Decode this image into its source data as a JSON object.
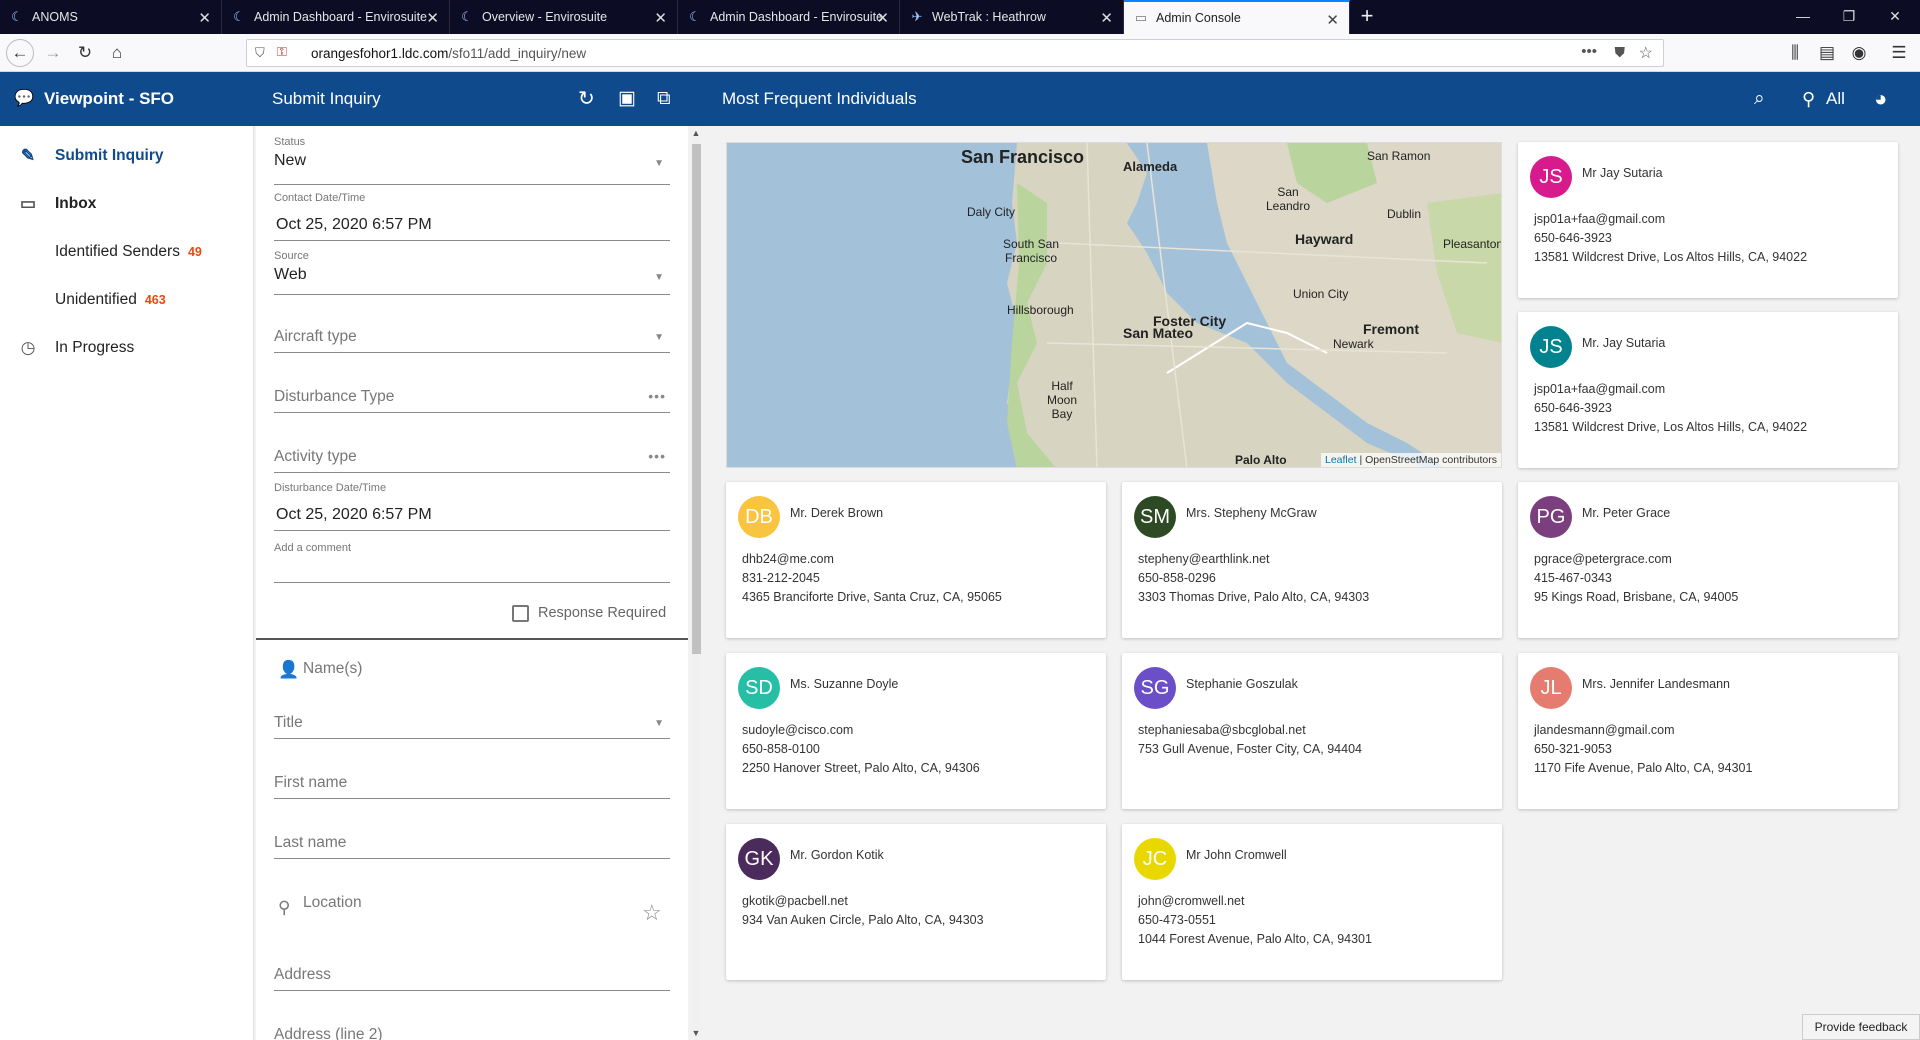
{
  "browser": {
    "tabs": [
      {
        "title": "ANOMS",
        "active": false
      },
      {
        "title": "Admin Dashboard - Envirosuite",
        "active": false
      },
      {
        "title": "Overview - Envirosuite",
        "active": false
      },
      {
        "title": "Admin Dashboard - Envirosuite",
        "active": false
      },
      {
        "title": "WebTrak : Heathrow",
        "active": false
      },
      {
        "title": "Admin Console",
        "active": true
      }
    ],
    "url_domain": "orangesfohor1.ldc.com",
    "url_path": "/sfo11/add_inquiry/new"
  },
  "app": {
    "title": "Viewpoint - SFO",
    "panel_title": "Submit Inquiry",
    "main_title": "Most Frequent Individuals",
    "filter_label": "All"
  },
  "sidebar": {
    "items": [
      {
        "label": "Submit Inquiry",
        "icon": "edit-icon",
        "badge": ""
      },
      {
        "label": "Inbox",
        "icon": "inbox-icon",
        "badge": ""
      },
      {
        "label": "Identified Senders",
        "icon": "",
        "badge": "49"
      },
      {
        "label": "Unidentified",
        "icon": "",
        "badge": "463"
      },
      {
        "label": "In Progress",
        "icon": "clock-icon",
        "badge": ""
      }
    ]
  },
  "form": {
    "status_label": "Status",
    "status_value": "New",
    "contact_label": "Contact Date/Time",
    "contact_value": "Oct 25, 2020 6:57 PM",
    "source_label": "Source",
    "source_value": "Web",
    "aircraft_placeholder": "Aircraft type",
    "disturbance_type_placeholder": "Disturbance Type",
    "activity_type_placeholder": "Activity type",
    "disturbance_date_label": "Disturbance Date/Time",
    "disturbance_date_value": "Oct 25, 2020 6:57 PM",
    "comment_label": "Add a comment",
    "response_required_label": "Response Required",
    "names_placeholder": "Name(s)",
    "title_placeholder": "Title",
    "first_name_placeholder": "First name",
    "last_name_placeholder": "Last name",
    "location_placeholder": "Location",
    "address_placeholder": "Address",
    "address2_placeholder": "Address (line 2)"
  },
  "map": {
    "places": [
      "San Francisco",
      "Alameda",
      "San Ramon",
      "San Leandro",
      "Daly City",
      "Dublin",
      "Hayward",
      "South San Francisco",
      "Pleasanton",
      "Union City",
      "Hillsborough",
      "Foster City",
      "San Mateo",
      "Fremont",
      "Newark",
      "Half Moon Bay",
      "Palo Alto"
    ],
    "attribution_link": "Leaflet",
    "attribution_text": "| OpenStreetMap contributors"
  },
  "individuals": [
    {
      "initials": "JS",
      "name": "Mr Jay Sutaria",
      "email": "jsp01a+faa@gmail.com",
      "phone": "650-646-3923",
      "address": "13581 Wildcrest Drive, Los Altos Hills, CA, 94022",
      "color": "#d81b8c"
    },
    {
      "initials": "JS",
      "name": "Mr. Jay Sutaria",
      "email": "jsp01a+faa@gmail.com",
      "phone": "650-646-3923",
      "address": "13581 Wildcrest Drive, Los Altos Hills, CA, 94022",
      "color": "#00838f"
    },
    {
      "initials": "DB",
      "name": "Mr. Derek Brown",
      "email": "dhb24@me.com",
      "phone": "831-212-2045",
      "address": "4365 Branciforte Drive, Santa Cruz, CA, 95065",
      "color": "#f9c440"
    },
    {
      "initials": "SM",
      "name": "Mrs. Stepheny McGraw",
      "email": "stepheny@earthlink.net",
      "phone": "650-858-0296",
      "address": "3303 Thomas Drive, Palo Alto, CA, 94303",
      "color": "#2e4a24"
    },
    {
      "initials": "PG",
      "name": "Mr. Peter Grace",
      "email": "pgrace@petergrace.com",
      "phone": "415-467-0343",
      "address": "95 Kings Road, Brisbane, CA, 94005",
      "color": "#7b3f7f"
    },
    {
      "initials": "SD",
      "name": "Ms. Suzanne Doyle",
      "email": "sudoyle@cisco.com",
      "phone": "650-858-0100",
      "address": "2250 Hanover Street, Palo Alto, CA, 94306",
      "color": "#26bfa6"
    },
    {
      "initials": "SG",
      "name": "Stephanie Goszulak",
      "email": "stephaniesaba@sbcglobal.net",
      "phone": "",
      "address": "753 Gull Avenue, Foster City, CA, 94404",
      "color": "#6a4fc8"
    },
    {
      "initials": "JL",
      "name": "Mrs. Jennifer Landesmann",
      "email": "jlandesmann@gmail.com",
      "phone": "650-321-9053",
      "address": "1170 Fife Avenue, Palo Alto, CA, 94301",
      "color": "#e57c6f"
    },
    {
      "initials": "GK",
      "name": "Mr. Gordon Kotik",
      "email": "gkotik@pacbell.net",
      "phone": "",
      "address": "934 Van Auken Circle, Palo Alto, CA, 94303",
      "color": "#4a2b5c"
    },
    {
      "initials": "JC",
      "name": "Mr John Cromwell",
      "email": "john@cromwell.net",
      "phone": "650-473-0551",
      "address": "1044 Forest Avenue, Palo Alto, CA, 94301",
      "color": "#e8d800"
    }
  ],
  "feedback_label": "Provide feedback"
}
